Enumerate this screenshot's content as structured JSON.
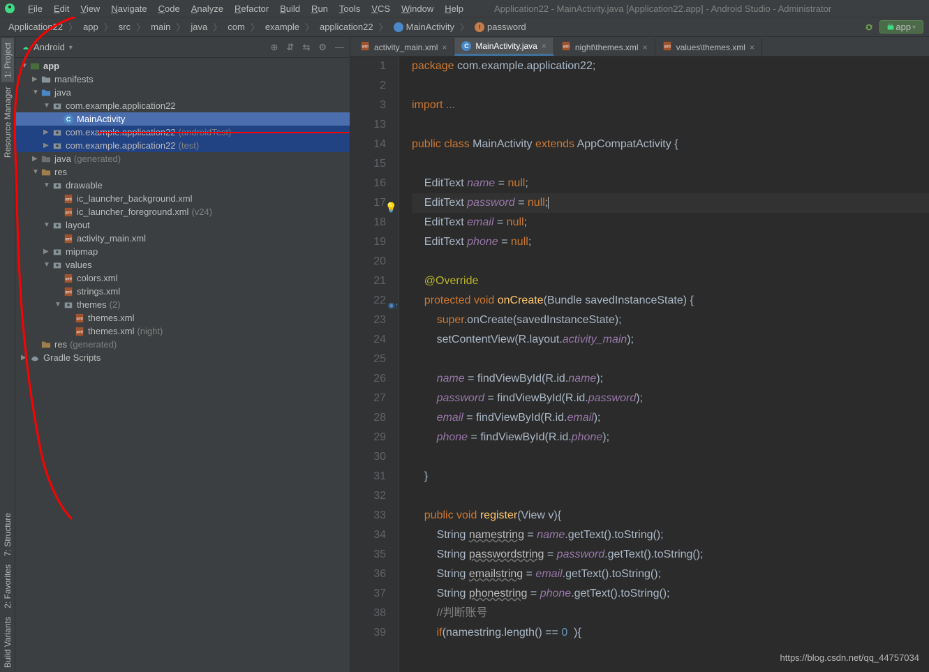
{
  "window_title": "Application22 - MainActivity.java [Application22.app] - Android Studio - Administrator",
  "menu": [
    "File",
    "Edit",
    "View",
    "Navigate",
    "Code",
    "Analyze",
    "Refactor",
    "Build",
    "Run",
    "Tools",
    "VCS",
    "Window",
    "Help"
  ],
  "breadcrumbs": [
    "Application22",
    "app",
    "src",
    "main",
    "java",
    "com",
    "example",
    "application22",
    "MainActivity",
    "password"
  ],
  "run_config": "app",
  "sidebar": {
    "mode": "Android",
    "items": [
      {
        "depth": 0,
        "arrow": "▼",
        "icon": "module",
        "label": "app",
        "bold": true
      },
      {
        "depth": 1,
        "arrow": "▶",
        "icon": "folder",
        "label": "manifests"
      },
      {
        "depth": 1,
        "arrow": "▼",
        "icon": "folder-blue",
        "label": "java"
      },
      {
        "depth": 2,
        "arrow": "▼",
        "icon": "pkg",
        "label": "com.example.application22"
      },
      {
        "depth": 3,
        "arrow": "",
        "icon": "class",
        "label": "MainActivity",
        "sel": true
      },
      {
        "depth": 2,
        "arrow": "▶",
        "icon": "pkg",
        "label": "com.example.application22",
        "dim": "(androidTest)",
        "hl": true
      },
      {
        "depth": 2,
        "arrow": "▶",
        "icon": "pkg",
        "label": "com.example.application22",
        "dim": "(test)",
        "hl": true
      },
      {
        "depth": 1,
        "arrow": "▶",
        "icon": "folder-gen",
        "label": "java",
        "dim": "(generated)"
      },
      {
        "depth": 1,
        "arrow": "▼",
        "icon": "folder-res",
        "label": "res"
      },
      {
        "depth": 2,
        "arrow": "▼",
        "icon": "pkg",
        "label": "drawable"
      },
      {
        "depth": 3,
        "arrow": "",
        "icon": "xml",
        "label": "ic_launcher_background.xml"
      },
      {
        "depth": 3,
        "arrow": "",
        "icon": "xml",
        "label": "ic_launcher_foreground.xml",
        "dim": "(v24)"
      },
      {
        "depth": 2,
        "arrow": "▼",
        "icon": "pkg",
        "label": "layout"
      },
      {
        "depth": 3,
        "arrow": "",
        "icon": "xml",
        "label": "activity_main.xml"
      },
      {
        "depth": 2,
        "arrow": "▶",
        "icon": "pkg",
        "label": "mipmap"
      },
      {
        "depth": 2,
        "arrow": "▼",
        "icon": "pkg",
        "label": "values"
      },
      {
        "depth": 3,
        "arrow": "",
        "icon": "xml",
        "label": "colors.xml"
      },
      {
        "depth": 3,
        "arrow": "",
        "icon": "xml",
        "label": "strings.xml"
      },
      {
        "depth": 3,
        "arrow": "▼",
        "icon": "pkg",
        "label": "themes",
        "dim": "(2)"
      },
      {
        "depth": 4,
        "arrow": "",
        "icon": "xml",
        "label": "themes.xml"
      },
      {
        "depth": 4,
        "arrow": "",
        "icon": "xml",
        "label": "themes.xml",
        "dim": "(night)"
      },
      {
        "depth": 1,
        "arrow": "",
        "icon": "folder-res",
        "label": "res",
        "dim": "(generated)"
      },
      {
        "depth": 0,
        "arrow": "▶",
        "icon": "gradle",
        "label": "Gradle Scripts"
      }
    ]
  },
  "left_tabs": [
    "1: Project",
    "Resource Manager",
    "7: Structure",
    "2: Favorites",
    "Build Variants"
  ],
  "editor_tabs": [
    {
      "icon": "xml",
      "label": "activity_main.xml",
      "active": false
    },
    {
      "icon": "class",
      "label": "MainActivity.java",
      "active": true
    },
    {
      "icon": "xml",
      "label": "night\\themes.xml",
      "active": false
    },
    {
      "icon": "xml",
      "label": "values\\themes.xml",
      "active": false
    }
  ],
  "code": {
    "start_line": 1,
    "lines": [
      {
        "n": 1,
        "html": "<span class='kw'>package</span> <span class='ident'>com.example.application22</span><span class='punc'>;</span>"
      },
      {
        "n": 2,
        "html": ""
      },
      {
        "n": 3,
        "html": "<span class='kw'>import</span> <span class='comment'>...</span>"
      },
      {
        "n": 13,
        "html": ""
      },
      {
        "n": 14,
        "html": "<span class='kw'>public class</span> <span class='type'>MainActivity</span> <span class='kw'>extends</span> <span class='type'>AppCompatActivity</span> <span class='punc'>{</span>"
      },
      {
        "n": 15,
        "html": ""
      },
      {
        "n": 16,
        "html": "    <span class='type'>EditText</span> <span class='field'>name</span> <span class='punc'>=</span> <span class='kw'>null</span><span class='punc'>;</span>"
      },
      {
        "n": 17,
        "html": "    <span class='type'>EditText</span> <span class='field'>password</span> <span class='punc'>=</span> <span class='kw'>null</span><span class='punc'>;</span><span class='caret'></span>",
        "cursor": true,
        "bulb": true
      },
      {
        "n": 18,
        "html": "    <span class='type'>EditText</span> <span class='field'>email</span> <span class='punc'>=</span> <span class='kw'>null</span><span class='punc'>;</span>"
      },
      {
        "n": 19,
        "html": "    <span class='type'>EditText</span> <span class='field'>phone</span> <span class='punc'>=</span> <span class='kw'>null</span><span class='punc'>;</span>"
      },
      {
        "n": 20,
        "html": ""
      },
      {
        "n": 21,
        "html": "    <span class='ann'>@Override</span>"
      },
      {
        "n": 22,
        "html": "    <span class='kw'>protected void</span> <span class='method'>onCreate</span><span class='punc'>(</span><span class='type'>Bundle</span> <span class='param'>savedInstanceState</span><span class='punc'>) {</span>",
        "override": true
      },
      {
        "n": 23,
        "html": "        <span class='kw'>super</span><span class='punc'>.</span><span class='ident'>onCreate(savedInstanceState);</span>"
      },
      {
        "n": 24,
        "html": "        <span class='ident'>setContentView(R.layout.</span><span class='field'>activity_main</span><span class='punc'>);</span>"
      },
      {
        "n": 25,
        "html": ""
      },
      {
        "n": 26,
        "html": "        <span class='field'>name</span> <span class='punc'>=</span> <span class='ident'>findViewById(R.id.</span><span class='field'>name</span><span class='punc'>);</span>"
      },
      {
        "n": 27,
        "html": "        <span class='field'>password</span> <span class='punc'>=</span> <span class='ident'>findViewById(R.id.</span><span class='field'>password</span><span class='punc'>);</span>"
      },
      {
        "n": 28,
        "html": "        <span class='field'>email</span> <span class='punc'>=</span> <span class='ident'>findViewById(R.id.</span><span class='field'>email</span><span class='punc'>);</span>"
      },
      {
        "n": 29,
        "html": "        <span class='field'>phone</span> <span class='punc'>=</span> <span class='ident'>findViewById(R.id.</span><span class='field'>phone</span><span class='punc'>);</span>"
      },
      {
        "n": 30,
        "html": ""
      },
      {
        "n": 31,
        "html": "    <span class='punc'>}</span>"
      },
      {
        "n": 32,
        "html": ""
      },
      {
        "n": 33,
        "html": "    <span class='kw'>public void</span> <span class='method'>register</span><span class='punc'>(</span><span class='type'>View</span> <span class='param'>v</span><span class='punc'>){</span>"
      },
      {
        "n": 34,
        "html": "        <span class='type'>String</span> <span style='text-decoration:underline wavy #707070'>namestring</span> <span class='punc'>=</span> <span class='field'>name</span><span class='ident'>.getText().toString();</span>"
      },
      {
        "n": 35,
        "html": "        <span class='type'>String</span> <span style='text-decoration:underline wavy #707070'>passwordstring</span> <span class='punc'>=</span> <span class='field'>password</span><span class='ident'>.getText().toString();</span>"
      },
      {
        "n": 36,
        "html": "        <span class='type'>String</span> <span style='text-decoration:underline wavy #707070'>emailstring</span> <span class='punc'>=</span> <span class='field'>email</span><span class='ident'>.getText().toString();</span>"
      },
      {
        "n": 37,
        "html": "        <span class='type'>String</span> <span style='text-decoration:underline wavy #707070'>phonestring</span> <span class='punc'>=</span> <span class='field'>phone</span><span class='ident'>.getText().toString();</span>"
      },
      {
        "n": 38,
        "html": "        <span class='comment'>//判断账号</span>"
      },
      {
        "n": 39,
        "html": "        <span class='kw'>if</span><span class='punc'>(</span><span class='ident'>namestring.length() ==</span> <span class='num'>0</span>  <span class='punc'>){</span>"
      }
    ]
  },
  "watermark": "https://blog.csdn.net/qq_44757034"
}
